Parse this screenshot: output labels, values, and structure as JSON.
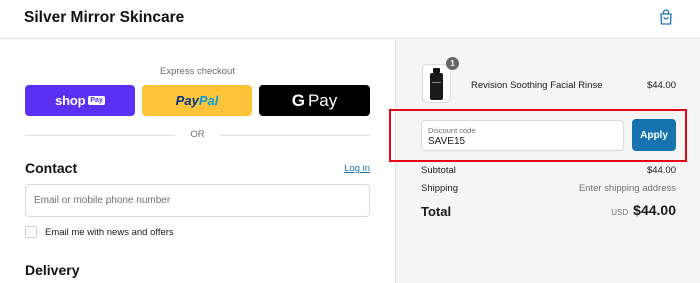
{
  "header": {
    "store_name": "Silver Mirror Skincare",
    "cart_icon": "shopping-bag-icon"
  },
  "express": {
    "label": "Express checkout",
    "shop_pay": {
      "text": "shop",
      "badge": "Pay",
      "color": "#5a31f4"
    },
    "paypal": {
      "part1": "Pay",
      "part2": "Pal",
      "color": "#ffc439"
    },
    "gpay": {
      "g": "G",
      "text": "Pay",
      "color": "#000000"
    }
  },
  "divider": {
    "or": "OR"
  },
  "contact": {
    "title": "Contact",
    "login_link": "Log in",
    "email_placeholder": "Email or mobile phone number",
    "news_label": "Email me with news and offers"
  },
  "delivery": {
    "title": "Delivery"
  },
  "summary": {
    "item": {
      "name": "Revision Soothing Facial Rinse",
      "price": "$44.00",
      "quantity": "1"
    },
    "discount": {
      "label": "Discount code",
      "value": "SAVE15",
      "apply_label": "Apply"
    },
    "subtotal": {
      "label": "Subtotal",
      "value": "$44.00"
    },
    "shipping": {
      "label": "Shipping",
      "value": "Enter shipping address"
    },
    "total": {
      "label": "Total",
      "currency": "USD",
      "value": "$44.00"
    }
  },
  "colors": {
    "accent": "#1773b0",
    "highlight": "#e30613"
  }
}
